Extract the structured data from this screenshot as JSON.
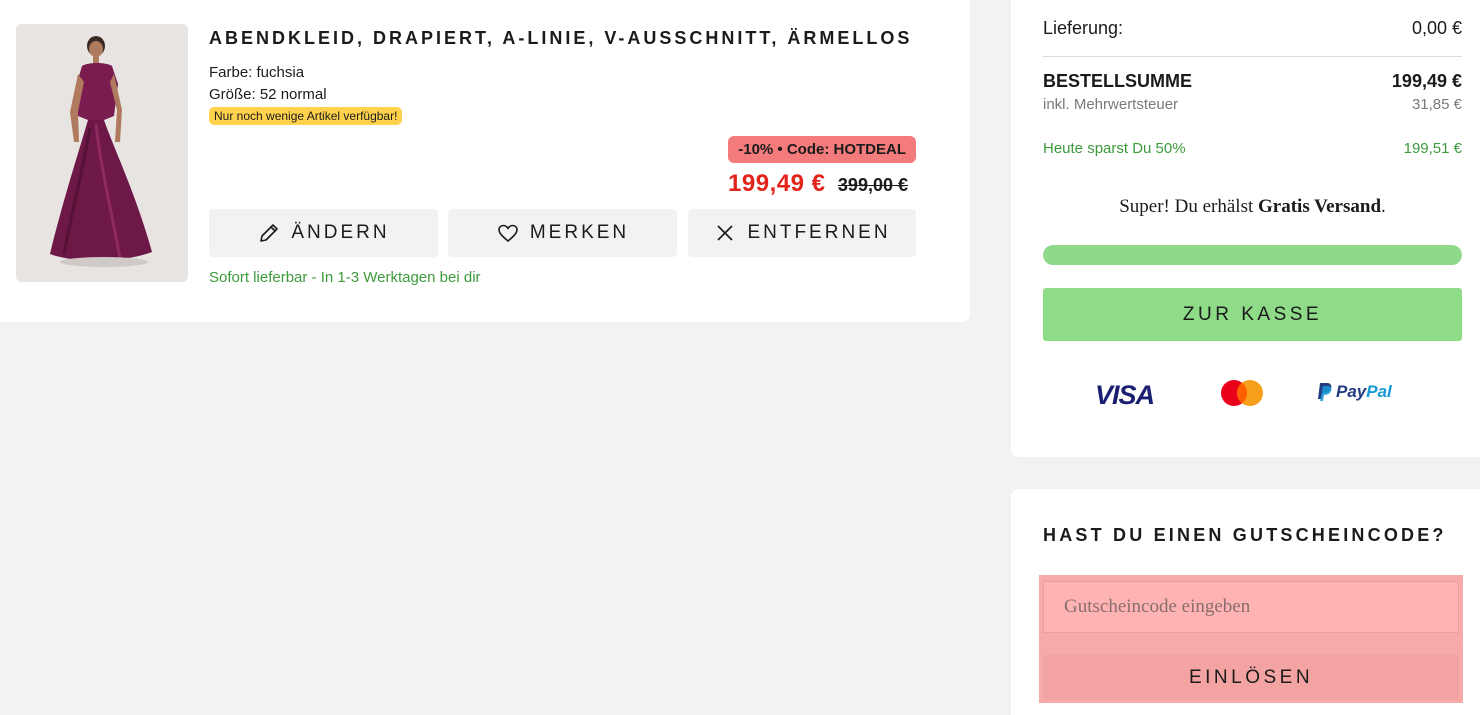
{
  "product": {
    "title": "ABENDKLEID, DRAPIERT, A-LINIE, V-AUSSCHNITT, ÄRMELLOS",
    "color_line": "Farbe: fuchsia",
    "size_line": "Größe: 52 normal",
    "stock_badge": "Nur noch wenige Artikel verfügbar!",
    "discount_badge": "-10% • Code: HOTDEAL",
    "price": "199,49 €",
    "old_price": "399,00 €",
    "actions": {
      "edit": "ÄNDERN",
      "save": "MERKEN",
      "remove": "ENTFERNEN"
    },
    "delivery": "Sofort lieferbar - In 1-3 Werktagen bei dir",
    "image_icon": "dress-photo",
    "dress_color": "#7a1c4f"
  },
  "summary": {
    "shipping_label": "Lieferung:",
    "shipping_value": "0,00 €",
    "total_label": "BESTELLSUMME",
    "total_value": "199,49 €",
    "tax_label": "inkl. Mehrwertsteuer",
    "tax_value": "31,85 €",
    "savings_label": "Heute sparst Du 50%",
    "savings_value": "199,51 €",
    "free_shipping_prefix": "Super! Du erhälst ",
    "free_shipping_bold": "Gratis Versand",
    "free_shipping_suffix": ".",
    "free_shipping_progress": 1.0,
    "checkout_label": "ZUR KASSE",
    "payment_methods": {
      "visa": "VISA",
      "mastercard_icon": "mastercard-icon",
      "paypal_pay": "Pay",
      "paypal_pal": "Pal"
    }
  },
  "voucher": {
    "title": "HAST DU EINEN GUTSCHEINCODE?",
    "placeholder": "Gutscheincode eingeben",
    "value": "",
    "redeem_label": "EINLÖSEN"
  },
  "colors": {
    "accent_green": "#8fdc88",
    "price_red": "#e2231a",
    "discount_badge": "#f47b7b",
    "stock_badge": "#ffd24d",
    "voucher_highlight": "#f7aaaa"
  }
}
